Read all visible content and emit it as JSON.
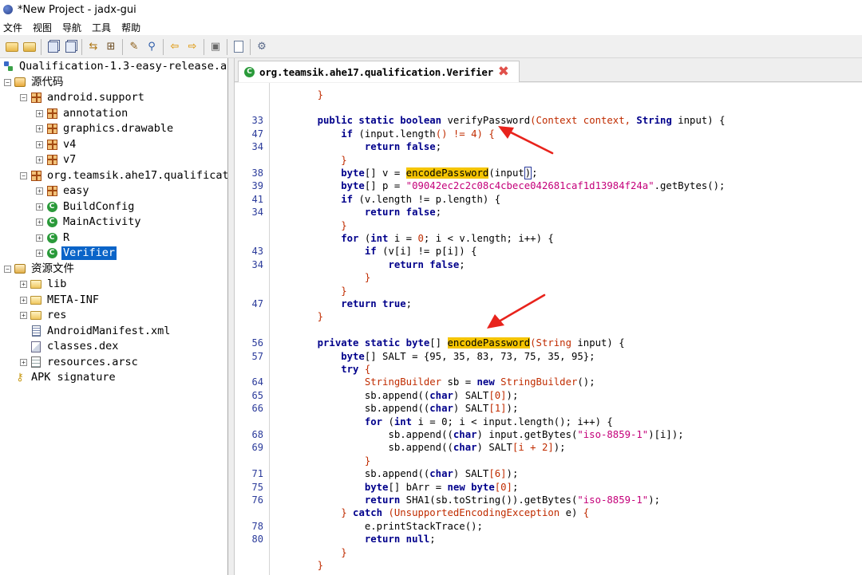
{
  "window": {
    "title": "*New Project - jadx-gui"
  },
  "menu": [
    "文件",
    "视图",
    "导航",
    "工具",
    "帮助"
  ],
  "toolbar_icons": [
    "open-file-icon",
    "add-files-icon",
    "save-all-icon",
    "export-icon",
    "sync-tree-icon",
    "flatten-packages-icon",
    "text-search-icon",
    "class-search-icon",
    "back-icon",
    "forward-icon",
    "decompile-all-icon",
    "log-viewer-icon",
    "preferences-icon"
  ],
  "tree": {
    "items": [
      {
        "label": "Qualification-1.3-easy-release.a",
        "icon": "apk-icon"
      },
      {
        "label": "源代码",
        "icon": "source-folder-icon"
      },
      {
        "label": "android.support",
        "icon": "package-icon"
      },
      {
        "label": "annotation",
        "icon": "package-icon"
      },
      {
        "label": "graphics.drawable",
        "icon": "package-icon"
      },
      {
        "label": "v4",
        "icon": "package-icon"
      },
      {
        "label": "v7",
        "icon": "package-icon"
      },
      {
        "label": "org.teamsik.ahe17.qualificat",
        "icon": "package-icon"
      },
      {
        "label": "easy",
        "icon": "package-icon"
      },
      {
        "label": "BuildConfig",
        "icon": "class-icon"
      },
      {
        "label": "MainActivity",
        "icon": "class-icon"
      },
      {
        "label": "R",
        "icon": "class-icon"
      },
      {
        "label": "Verifier",
        "icon": "class-icon"
      },
      {
        "label": "资源文件",
        "icon": "resources-folder-icon"
      },
      {
        "label": "lib",
        "icon": "folder-icon"
      },
      {
        "label": "META-INF",
        "icon": "folder-icon"
      },
      {
        "label": "res",
        "icon": "folder-icon"
      },
      {
        "label": "AndroidManifest.xml",
        "icon": "xml-file-icon"
      },
      {
        "label": "classes.dex",
        "icon": "dex-file-icon"
      },
      {
        "label": "resources.arsc",
        "icon": "arsc-file-icon"
      },
      {
        "label": "APK signature",
        "icon": "key-icon"
      }
    ],
    "selected": "Verifier"
  },
  "editor": {
    "tab_label": "org.teamsik.ahe17.qualification.Verifier",
    "highlight_color": "#f5c500",
    "lines": [
      {
        "ln": "",
        "t": [
          [
            "p",
            "    }"
          ]
        ]
      },
      {
        "ln": "",
        "t": []
      },
      {
        "ln": "33",
        "t": [
          [
            "k",
            "    public static boolean "
          ],
          [
            "n",
            "verifyPassword"
          ],
          [
            "p",
            "(Context context, "
          ],
          [
            "k",
            "String"
          ],
          [
            "n",
            " input) {"
          ]
        ]
      },
      {
        "ln": "47",
        "t": [
          [
            "k",
            "        if "
          ],
          [
            "n",
            "(input.length"
          ],
          [
            "p",
            "() != 4) {"
          ]
        ]
      },
      {
        "ln": "34",
        "t": [
          [
            "k",
            "            return false"
          ],
          [
            "n",
            ";"
          ]
        ]
      },
      {
        "ln": "",
        "t": [
          [
            "p",
            "        }"
          ]
        ]
      },
      {
        "ln": "38",
        "t": [
          [
            "k",
            "        byte"
          ],
          [
            "n",
            "[] v = "
          ],
          [
            "h",
            "encodePassword"
          ],
          [
            "n",
            "(input"
          ],
          [
            "c",
            ")"
          ],
          [
            "n",
            ";"
          ]
        ]
      },
      {
        "ln": "39",
        "t": [
          [
            "k",
            "        byte"
          ],
          [
            "n",
            "[] p = "
          ],
          [
            "s",
            "\"09042ec2c2c08c4cbece042681caf1d13984f24a\""
          ],
          [
            "n",
            ".getBytes();"
          ]
        ]
      },
      {
        "ln": "41",
        "t": [
          [
            "k",
            "        if "
          ],
          [
            "n",
            "(v.length != p.length) {"
          ]
        ]
      },
      {
        "ln": "34",
        "t": [
          [
            "k",
            "            return false"
          ],
          [
            "n",
            ";"
          ]
        ]
      },
      {
        "ln": "",
        "t": [
          [
            "p",
            "        }"
          ]
        ]
      },
      {
        "ln": "",
        "t": [
          [
            "k",
            "        for "
          ],
          [
            "n",
            "("
          ],
          [
            "k",
            "int"
          ],
          [
            "n",
            " i = "
          ],
          [
            "p",
            "0"
          ],
          [
            "n",
            "; i < v.length; i++) {"
          ]
        ]
      },
      {
        "ln": "43",
        "t": [
          [
            "k",
            "            if "
          ],
          [
            "n",
            "(v[i] != p[i]) {"
          ]
        ]
      },
      {
        "ln": "34",
        "t": [
          [
            "k",
            "                return false"
          ],
          [
            "n",
            ";"
          ]
        ]
      },
      {
        "ln": "",
        "t": [
          [
            "p",
            "            }"
          ]
        ]
      },
      {
        "ln": "",
        "t": [
          [
            "p",
            "        }"
          ]
        ]
      },
      {
        "ln": "47",
        "t": [
          [
            "k",
            "        return true"
          ],
          [
            "n",
            ";"
          ]
        ]
      },
      {
        "ln": "",
        "t": [
          [
            "p",
            "    }"
          ]
        ]
      },
      {
        "ln": "",
        "t": []
      },
      {
        "ln": "56",
        "t": [
          [
            "k",
            "    private static byte"
          ],
          [
            "n",
            "[] "
          ],
          [
            "h",
            "encodePassword"
          ],
          [
            "p",
            "(String"
          ],
          [
            "n",
            " input) {"
          ]
        ]
      },
      {
        "ln": "57",
        "t": [
          [
            "k",
            "        byte"
          ],
          [
            "n",
            "[] SALT = {95, 35, 83, 73, 75, 35, 95};"
          ]
        ]
      },
      {
        "ln": "",
        "t": [
          [
            "k",
            "        try "
          ],
          [
            "p",
            "{"
          ]
        ]
      },
      {
        "ln": "64",
        "t": [
          [
            "p",
            "            StringBuilder"
          ],
          [
            "n",
            " sb = "
          ],
          [
            "k",
            "new "
          ],
          [
            "p",
            "StringBuilder"
          ],
          [
            "n",
            "();"
          ]
        ]
      },
      {
        "ln": "65",
        "t": [
          [
            "n",
            "            sb.append(("
          ],
          [
            "k",
            "char"
          ],
          [
            "n",
            ") SALT"
          ],
          [
            "p",
            "[0]"
          ],
          [
            "n",
            ");"
          ]
        ]
      },
      {
        "ln": "66",
        "t": [
          [
            "n",
            "            sb.append(("
          ],
          [
            "k",
            "char"
          ],
          [
            "n",
            ") SALT"
          ],
          [
            "p",
            "[1]"
          ],
          [
            "n",
            ");"
          ]
        ]
      },
      {
        "ln": "",
        "t": [
          [
            "k",
            "            for "
          ],
          [
            "n",
            "("
          ],
          [
            "k",
            "int"
          ],
          [
            "n",
            " i = 0; i < input.length(); i++) {"
          ]
        ]
      },
      {
        "ln": "68",
        "t": [
          [
            "n",
            "                sb.append(("
          ],
          [
            "k",
            "char"
          ],
          [
            "n",
            ") input.getBytes("
          ],
          [
            "s",
            "\"iso-8859-1\""
          ],
          [
            "n",
            ")[i]);"
          ]
        ]
      },
      {
        "ln": "69",
        "t": [
          [
            "n",
            "                sb.append(("
          ],
          [
            "k",
            "char"
          ],
          [
            "n",
            ") SALT"
          ],
          [
            "p",
            "[i + 2]"
          ],
          [
            "n",
            ");"
          ]
        ]
      },
      {
        "ln": "",
        "t": [
          [
            "p",
            "            }"
          ]
        ]
      },
      {
        "ln": "71",
        "t": [
          [
            "n",
            "            sb.append(("
          ],
          [
            "k",
            "char"
          ],
          [
            "n",
            ") SALT"
          ],
          [
            "p",
            "[6]"
          ],
          [
            "n",
            ");"
          ]
        ]
      },
      {
        "ln": "75",
        "t": [
          [
            "k",
            "            byte"
          ],
          [
            "n",
            "[] bArr = "
          ],
          [
            "k",
            "new byte"
          ],
          [
            "p",
            "[0]"
          ],
          [
            "n",
            ";"
          ]
        ]
      },
      {
        "ln": "76",
        "t": [
          [
            "k",
            "            return "
          ],
          [
            "n",
            "SHA1(sb.toString()).getBytes("
          ],
          [
            "s",
            "\"iso-8859-1\""
          ],
          [
            "n",
            ");"
          ]
        ]
      },
      {
        "ln": "",
        "t": [
          [
            "p",
            "        } "
          ],
          [
            "k",
            "catch "
          ],
          [
            "p",
            "(UnsupportedEncodingException"
          ],
          [
            "n",
            " e) "
          ],
          [
            "p",
            "{"
          ]
        ]
      },
      {
        "ln": "78",
        "t": [
          [
            "n",
            "            e.printStackTrace();"
          ]
        ]
      },
      {
        "ln": "80",
        "t": [
          [
            "k",
            "            return null"
          ],
          [
            "n",
            ";"
          ]
        ]
      },
      {
        "ln": "",
        "t": [
          [
            "p",
            "        }"
          ]
        ]
      },
      {
        "ln": "",
        "t": [
          [
            "p",
            "    }"
          ]
        ]
      }
    ]
  }
}
